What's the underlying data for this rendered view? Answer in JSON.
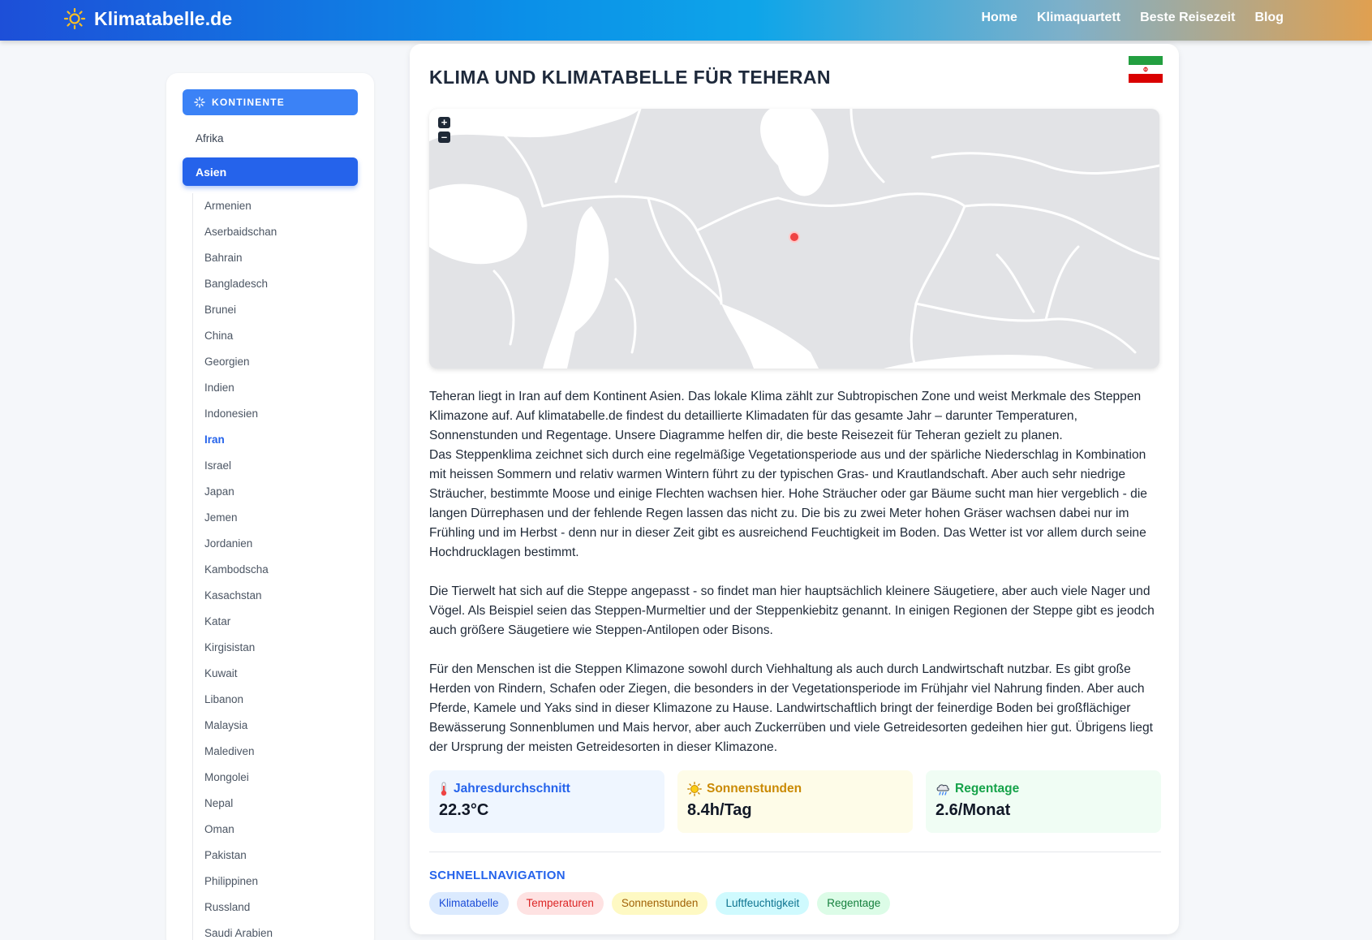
{
  "header": {
    "brand": "Klimatabelle.de",
    "brand_icon": "sun-icon",
    "nav": [
      "Home",
      "Klimaquartett",
      "Beste Reisezeit",
      "Blog"
    ]
  },
  "sidebar": {
    "continents_label": "Kontinente",
    "continents_icon": "sparkle-icon",
    "continents": [
      "Afrika",
      "Asien"
    ],
    "active_continent": "Asien",
    "countries": [
      "Armenien",
      "Aserbaidschan",
      "Bahrain",
      "Bangladesch",
      "Brunei",
      "China",
      "Georgien",
      "Indien",
      "Indonesien",
      "Iran",
      "Israel",
      "Japan",
      "Jemen",
      "Jordanien",
      "Kambodscha",
      "Kasachstan",
      "Katar",
      "Kirgisistan",
      "Kuwait",
      "Libanon",
      "Malaysia",
      "Malediven",
      "Mongolei",
      "Nepal",
      "Oman",
      "Pakistan",
      "Philippinen",
      "Russland",
      "Saudi Arabien"
    ],
    "active_country": "Iran"
  },
  "main": {
    "title": "Klima und Klimatabelle für Teheran",
    "flag": "iran-flag-icon",
    "map": {
      "zoom_in": "+",
      "zoom_out": "–",
      "marker": "location-marker-icon"
    },
    "paragraphs": [
      "Teheran liegt in Iran auf dem Kontinent Asien. Das lokale Klima zählt zur Subtropischen Zone und weist Merkmale des Steppen Klimazone auf. Auf klimatabelle.de findest du detaillierte Klimadaten für das gesamte Jahr – darunter Temperaturen, Sonnenstunden und Regentage. Unsere Diagramme helfen dir, die beste Reisezeit für Teheran gezielt zu planen.",
      "Das Steppenklima zeichnet sich durch eine regelmäßige Vegetationsperiode aus und der spärliche Niederschlag in Kombination mit heissen Sommern und relativ warmen Wintern führt zu der typischen Gras- und Krautlandschaft. Aber auch sehr niedrige Sträucher, bestimmte Moose und einige Flechten wachsen hier. Hohe Sträucher oder gar Bäume sucht man hier vergeblich - die langen Dürrephasen und der fehlende Regen lassen das nicht zu. Die bis zu zwei Meter hohen Gräser wachsen dabei nur im Frühling und im Herbst - denn nur in dieser Zeit gibt es ausreichend Feuchtigkeit im Boden. Das Wetter ist vor allem durch seine Hochdrucklagen bestimmt.",
      "Die Tierwelt hat sich auf die Steppe angepasst - so findet man hier hauptsächlich kleinere Säugetiere, aber auch viele Nager und Vögel. Als Beispiel seien das Steppen-Murmeltier und der Steppenkiebitz genannt. In einigen Regionen der Steppe gibt es jeodch auch größere Säugetiere wie Steppen-Antilopen oder Bisons.",
      "Für den Menschen ist die Steppen Klimazone sowohl durch Viehhaltung als auch durch Landwirtschaft nutzbar. Es gibt große Herden von Rindern, Schafen oder Ziegen, die besonders in der Vegetationsperiode im Frühjahr viel Nahrung finden. Aber auch Pferde, Kamele und Yaks sind in dieser Klimazone zu Hause. Landwirtschaftlich bringt der feinerdige Boden bei großflächiger Bewässerung Sonnenblumen und Mais hervor, aber auch Zuckerrüben und viele Getreidesorten gedeihen hier gut. Übrigens liegt der Ursprung der meisten Getreidesorten in dieser Klimazone."
    ],
    "stats": [
      {
        "label": "Jahresdurchschnitt",
        "value": "22.3°C",
        "icon": "thermometer-icon",
        "color": "#2563eb"
      },
      {
        "label": "Sonnenstunden",
        "value": "8.4h/Tag",
        "icon": "sun-icon",
        "color": "#ca8a04"
      },
      {
        "label": "Regentage",
        "value": "2.6/Monat",
        "icon": "rain-cloud-icon",
        "color": "#16a34a"
      }
    ],
    "quicknav_title": "Schnellnavigation",
    "quicknav": [
      "Klimatabelle",
      "Temperaturen",
      "Sonnenstunden",
      "Luftfeuchtigkeit",
      "Regentage"
    ]
  }
}
